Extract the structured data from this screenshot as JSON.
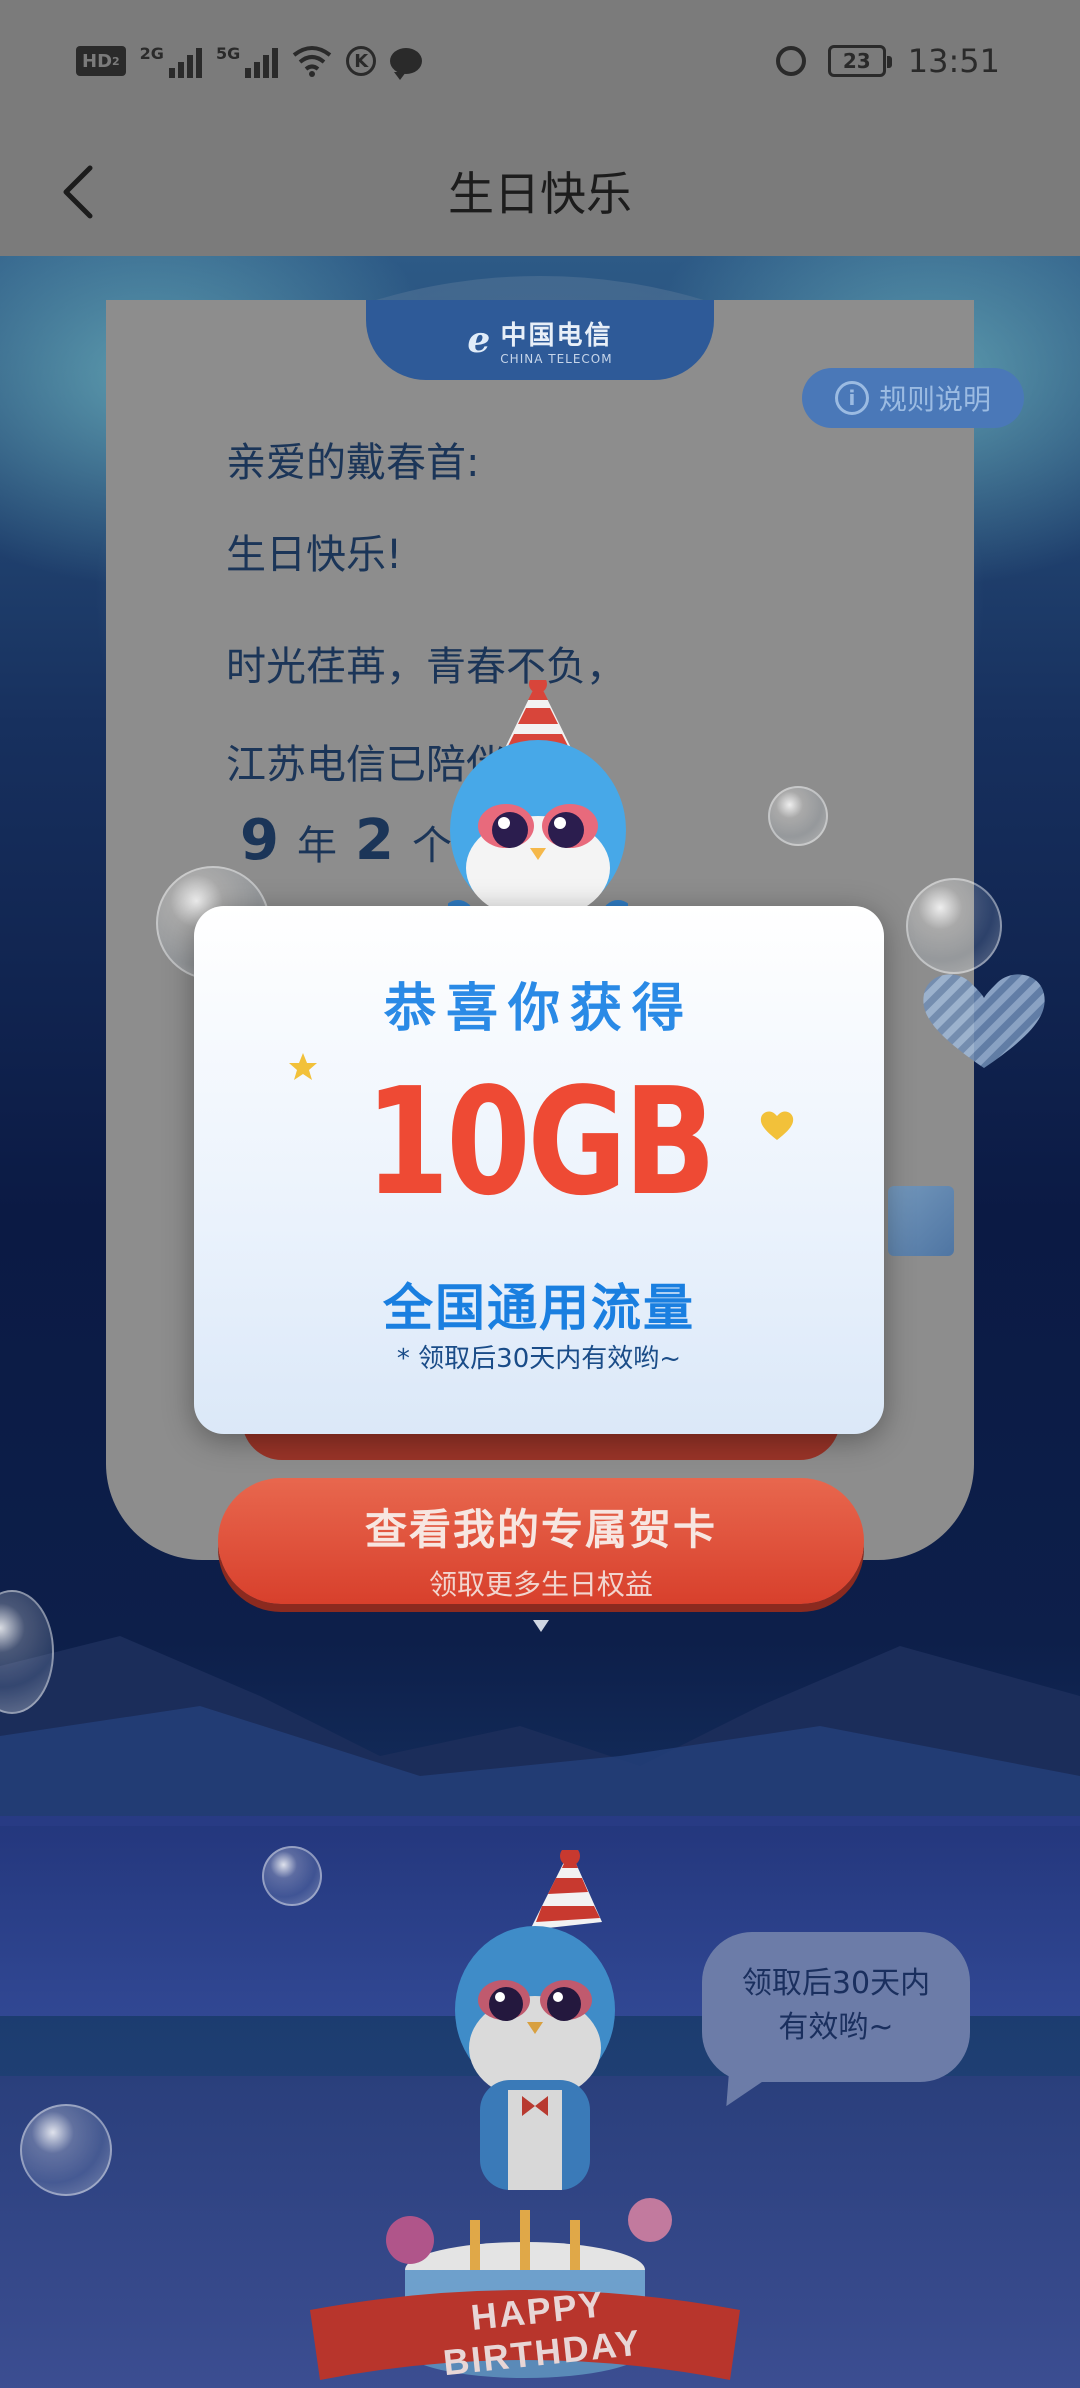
{
  "status_bar": {
    "hd_label": "HD",
    "hd_sub": "2",
    "sig1_label": "2G",
    "sig2_label": "5G",
    "k_label": "K",
    "battery": "23",
    "time": "13:51"
  },
  "header": {
    "title": "生日快乐"
  },
  "telecom": {
    "name": "中国电信",
    "en": "CHINA TELECOM"
  },
  "rules_button": {
    "label": "规则说明"
  },
  "letter": {
    "greeting": "亲爱的戴春首:",
    "wish": "生日快乐!",
    "line3": "时光荏苒，青春不负，",
    "line4": "江苏电信已陪伴",
    "years_num": "9",
    "years_unit": "年",
    "months_num": "2",
    "months_unit": "个"
  },
  "popup": {
    "title": "恭喜你获得",
    "amount": "10GB",
    "type": "全国通用流量",
    "note": "*  领取后30天内有效哟~"
  },
  "card_button": {
    "title": "查看我的专属贺卡",
    "subtitle": "领取更多生日权益"
  },
  "speech": {
    "line1": "领取后30天内",
    "line2": "有效哟~"
  },
  "cake": {
    "banner": "HAPPY BIRTHDAY"
  },
  "colors": {
    "accent_blue": "#2a8ae6",
    "amount_red": "#ee4a34",
    "button_red": "#d8402c"
  }
}
